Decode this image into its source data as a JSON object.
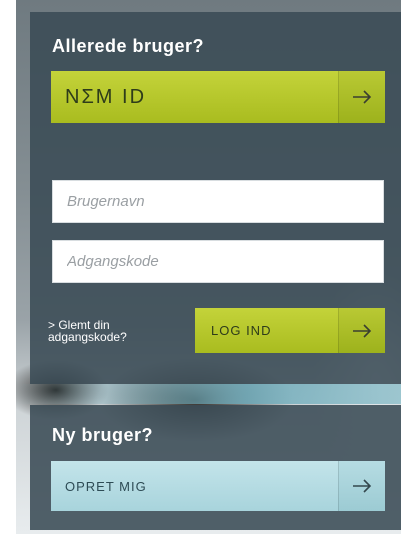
{
  "existing_user": {
    "title": "Allerede bruger?",
    "nemid_label": "NΣM ID",
    "username_placeholder": "Brugernavn",
    "password_placeholder": "Adgangskode",
    "forgot_link_line1": "> Glemt din",
    "forgot_link_line2": "adgangskode?",
    "login_label": "LOG IND"
  },
  "new_user": {
    "title": "Ny bruger?",
    "create_label": "OPRET MIG"
  },
  "icons": {
    "arrow": "arrow-right-icon"
  },
  "colors": {
    "panel": "#3a4b55",
    "accent_green": "#b4c62a",
    "accent_blue": "#b6dce3"
  }
}
